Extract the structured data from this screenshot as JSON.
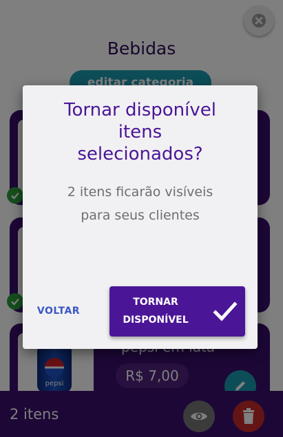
{
  "page": {
    "title": "Bebidas",
    "edit_category_label": "editar categoria",
    "product": {
      "name": "pepsi em lata",
      "price": "R$ 7,00",
      "brand_text": "pepsi"
    },
    "bottom_bar": {
      "count_label": "2 itens"
    }
  },
  "dialog": {
    "title_line1": "Tornar disponível",
    "title_line2": "itens",
    "title_line3": "selecionados?",
    "message_line1": "2 itens ficarão visíveis",
    "message_line2": "para seus clientes",
    "back_label": "VOLTAR",
    "confirm_line1": "TORNAR",
    "confirm_line2": "DISPONÍVEL"
  },
  "colors": {
    "primary": "#4b1597",
    "card": "#3a0f6e",
    "accent": "#1b9bb0",
    "success": "#2d9e3c",
    "danger": "#c62828",
    "link": "#3b57c4"
  },
  "icons": {
    "close": "close-icon",
    "check": "check-icon",
    "edit": "pencil-icon",
    "visibility": "eye-icon",
    "delete": "trash-icon",
    "confirm": "checkmark-icon"
  }
}
